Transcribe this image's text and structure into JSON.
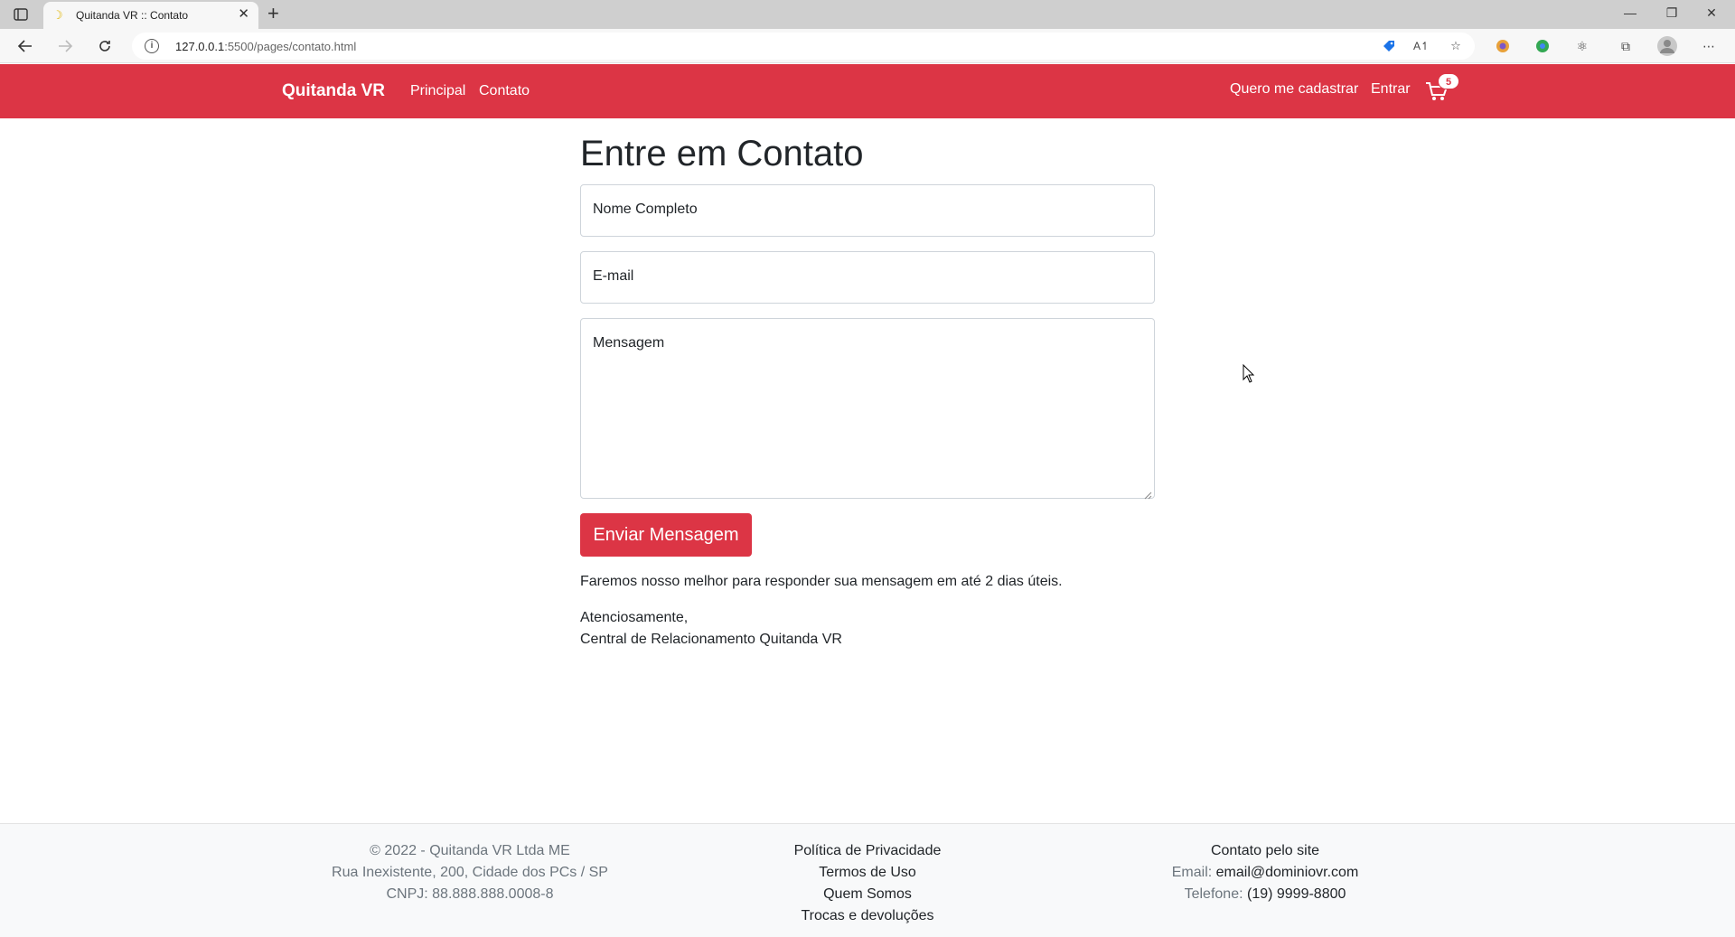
{
  "browser": {
    "tab_title": "Quitanda VR :: Contato",
    "url_host": "127.0.0.1",
    "url_path": ":5500/pages/contato.html"
  },
  "navbar": {
    "brand": "Quitanda VR",
    "links": [
      "Principal",
      "Contato"
    ],
    "register": "Quero me cadastrar",
    "login": "Entrar",
    "cart_count": "5"
  },
  "main": {
    "title": "Entre em Contato",
    "name_placeholder": "Nome Completo",
    "email_placeholder": "E-mail",
    "message_placeholder": "Mensagem",
    "submit_label": "Enviar Mensagem",
    "note": "Faremos nosso melhor para responder sua mensagem em até 2 dias úteis.",
    "closing": "Atenciosamente,",
    "signature": "Central de Relacionamento Quitanda VR"
  },
  "footer": {
    "company": [
      "© 2022 - Quitanda VR Ltda ME",
      "Rua Inexistente, 200, Cidade dos PCs / SP",
      "CNPJ: 88.888.888.0008-8"
    ],
    "links": [
      "Política de Privacidade",
      "Termos de Uso",
      "Quem Somos",
      "Trocas e devoluções"
    ],
    "contact_title": "Contato pelo site",
    "email_label": "Email:",
    "email_value": "email@dominiovr.com",
    "phone_label": "Telefone:",
    "phone_value": "(19) 9999-8800"
  },
  "colors": {
    "brand": "#dc3545",
    "footer_bg": "#f8f9fa"
  }
}
